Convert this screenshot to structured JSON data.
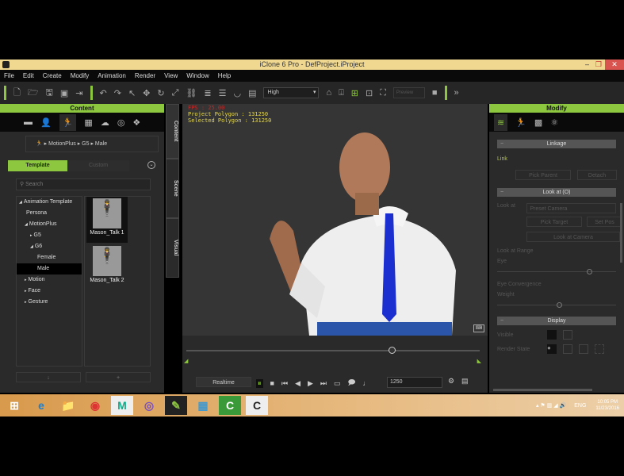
{
  "window": {
    "title": "iClone 6 Pro - DefProject.iProject"
  },
  "menu": [
    "File",
    "Edit",
    "Create",
    "Modify",
    "Animation",
    "Render",
    "View",
    "Window",
    "Help"
  ],
  "toolbar": {
    "quality": "High",
    "preview_select": "Preview"
  },
  "content_panel": {
    "title": "Content",
    "breadcrumb": [
      "MotionPlus",
      "G5",
      "Male"
    ],
    "tabs": [
      "Template",
      "Custom"
    ],
    "search_placeholder": "Search",
    "tree": [
      {
        "label": "Animation Template",
        "indent": 0,
        "arrow": "◢"
      },
      {
        "label": "Persona",
        "indent": 1,
        "arrow": ""
      },
      {
        "label": "MotionPlus",
        "indent": 1,
        "arrow": "◢"
      },
      {
        "label": "G5",
        "indent": 2,
        "arrow": "▸"
      },
      {
        "label": "G6",
        "indent": 2,
        "arrow": "◢"
      },
      {
        "label": "Female",
        "indent": 3,
        "arrow": ""
      },
      {
        "label": "Male",
        "indent": 3,
        "arrow": "",
        "selected": true
      },
      {
        "label": "Motion",
        "indent": 1,
        "arrow": "▸"
      },
      {
        "label": "Face",
        "indent": 1,
        "arrow": "▸"
      },
      {
        "label": "Gesture",
        "indent": 1,
        "arrow": "▸"
      }
    ],
    "items": [
      "Mason_Talk 1",
      "Mason_Talk 2"
    ],
    "buttons": [
      "↓",
      "+"
    ]
  },
  "side_tabs": [
    "Content",
    "Scene",
    "Visual"
  ],
  "viewport": {
    "fps": "FPS : 25.00",
    "project_polygon": "Project Polygon : 131250",
    "selected_polygon": "Selected Polygon : 131250"
  },
  "timeline": {
    "realtime": "Realtime",
    "frame": "1250",
    "progress": 0.7
  },
  "modify_panel": {
    "title": "Modify",
    "linkage": {
      "title": "Linkage",
      "link_label": "Link",
      "pick_parent": "Pick Parent",
      "detach": "Detach"
    },
    "look_at": {
      "title": "Look at (O)",
      "look_at_label": "Look at",
      "target": "Preset Camera",
      "pick_target": "Pick Target",
      "set_pos": "Set Pos",
      "look_at_camera": "Look at Camera",
      "range_label": "Look at Range",
      "eye_label": "Eye",
      "eye_value": 0.75,
      "convergence_label": "Eye Convergence",
      "weight_label": "Weight",
      "weight_value": 0.5
    },
    "display": {
      "title": "Display",
      "visible_label": "Visible",
      "render_state_label": "Render State"
    }
  },
  "taskbar": {
    "apps": [
      "⊞",
      "e",
      "📁",
      "◉",
      "M",
      "◎",
      "✎",
      "▦",
      "C",
      "C"
    ],
    "lang": "ENG",
    "time": "10:05 PM",
    "date": "11/23/2016"
  },
  "colors": {
    "accent": "#8dc63f",
    "titlebar": "#f0d890"
  }
}
